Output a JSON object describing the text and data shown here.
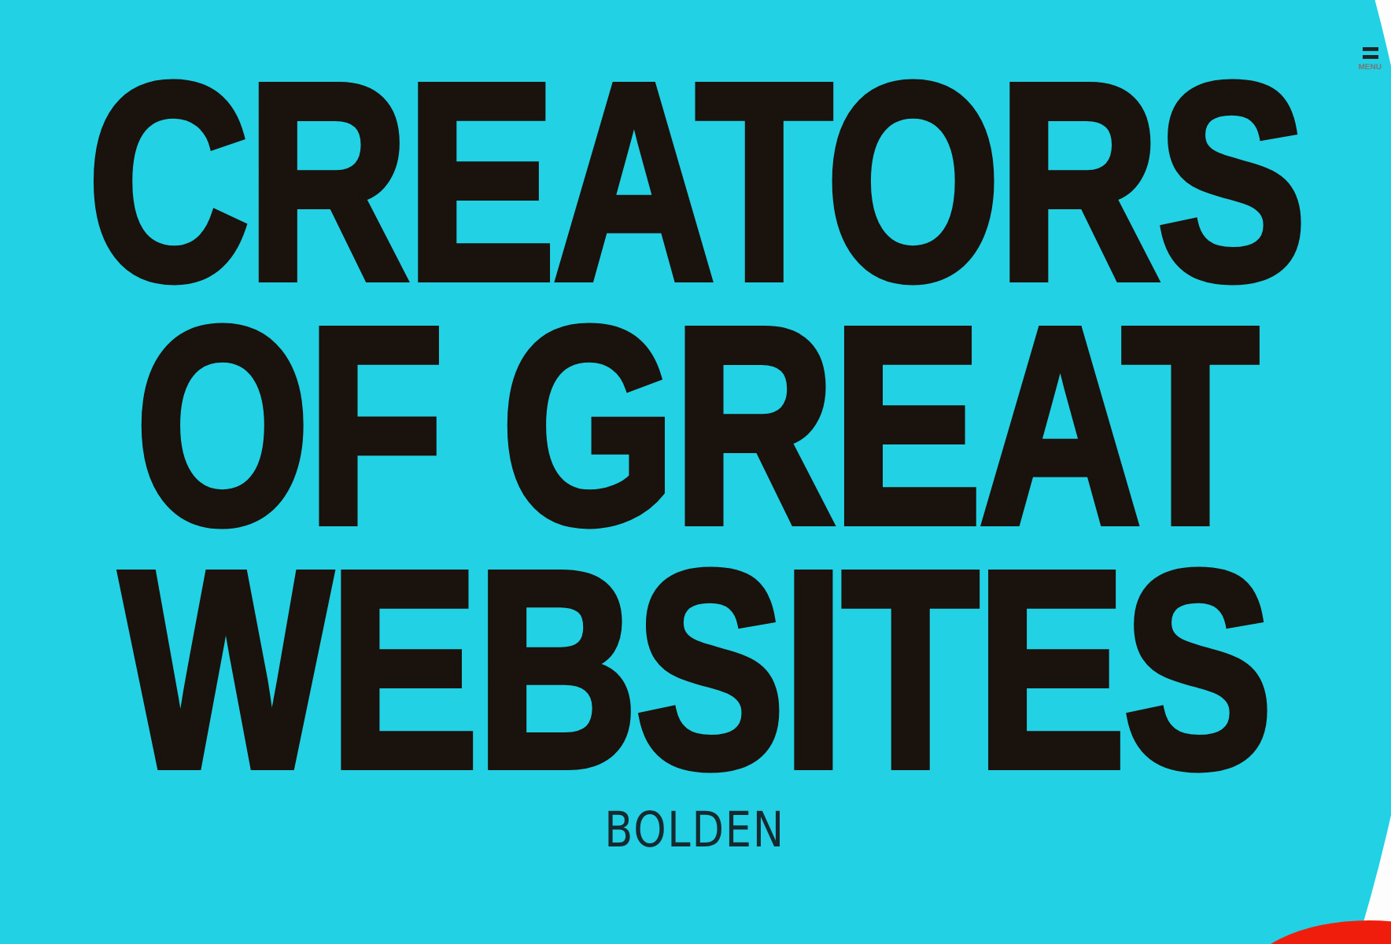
{
  "menu": {
    "label": "MENU"
  },
  "headline_lines": [
    "CREATORS",
    "OF GREAT",
    "WEBSITES"
  ],
  "logo": {
    "text": "BOLDEN"
  }
}
